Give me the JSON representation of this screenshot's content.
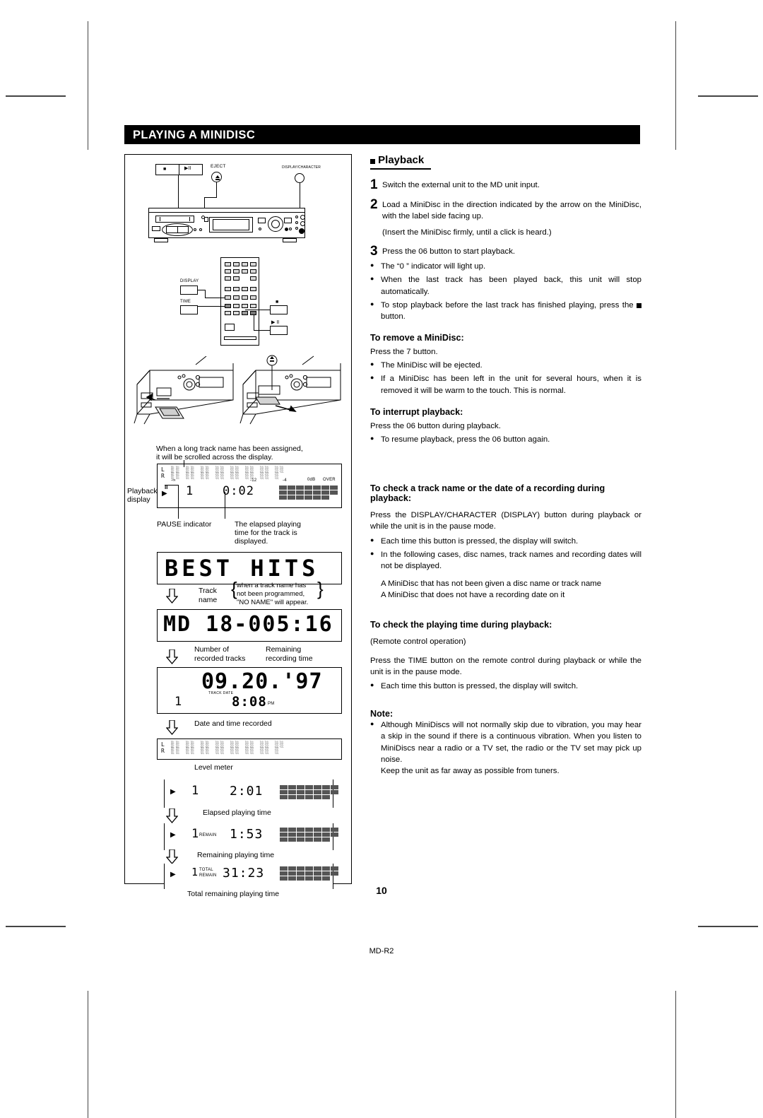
{
  "page": {
    "section_title": "PLAYING A MINIDISC",
    "page_number": "10",
    "footer_code": "MD-R2"
  },
  "diagram": {
    "deck_callouts": {
      "stop": "■",
      "play_pause": "▶II",
      "eject": "EJECT",
      "display_character": "DISPLAY/CHARACTER"
    },
    "remote_callouts": {
      "display": "DISPLAY",
      "time": "TIME",
      "stop": "■",
      "play_pause": "▶ II"
    },
    "scroll_note_line1": "When a long track name has been assigned,",
    "scroll_note_line2": "it will be scrolled across the display.",
    "playback_display_label_line1": "Playback",
    "playback_display_label_line2": "display",
    "pause_indicator_label": "PAUSE indicator",
    "elapsed_note_line1": "The elapsed playing",
    "elapsed_note_line2": "time for the track is",
    "elapsed_note_line3": "displayed.",
    "level_meter_label": "Level meter",
    "track_name_label_line1": "Track",
    "track_name_label_line2": "name",
    "no_name_note_line1": "when a track name has",
    "no_name_note_line2": "not been programmed,",
    "no_name_note_line3": "\"NO NAME\" will appear.",
    "num_tracks_label_line1": "Number of",
    "num_tracks_label_line2": "recorded tracks",
    "remaining_rec_label_line1": "Remaining",
    "remaining_rec_label_line2": "recording time",
    "date_time_label": "Date and time recorded",
    "elapsed_playing_label": "Elapsed playing time",
    "remaining_playing_label": "Remaining playing time",
    "total_remaining_label": "Total remaining playing time"
  },
  "lcd": {
    "meter_scale": {
      "minf": "-∞",
      "m12": "-12",
      "m4": "-4",
      "zero": "0dB",
      "over": "OVER"
    },
    "meter_left_id": "L",
    "meter_right_id": "R",
    "playback": {
      "track": "1",
      "time": "0:02"
    },
    "disc_name": "BEST  HITS",
    "disc_info": "MD  18-005:16",
    "date": {
      "value": "09.20.'97",
      "label": "TRACK DATE",
      "track": "1",
      "clock": "8:08",
      "meridiem": "PM"
    },
    "elapsed": {
      "track": "1",
      "time": "2:01"
    },
    "remaining": {
      "track": "1",
      "flag": "REMAIN",
      "time": "1:53"
    },
    "total_remaining": {
      "track": "1",
      "flag1": "TOTAL",
      "flag2": "REMAIN",
      "time": "31:23"
    }
  },
  "body": {
    "playback_heading": "Playback",
    "step1": "Switch the external unit to the MD unit input.",
    "step2_a": "Load a MiniDisc in the direction indicated by the arrow on the MiniDisc, with the label side facing up.",
    "step2_b": "(Insert the MiniDisc firmly, until a click is heard.)",
    "step3": "Press the 06  button to start playback.",
    "step3_b1": "The “0 ” indicator will light up.",
    "step3_b2": "When the last track has been played back, this unit will stop automatically.",
    "step3_b3_pre": "To stop playback before the last track has finished playing, press the ",
    "step3_b3_post": " button.",
    "remove_heading": "To remove a MiniDisc:",
    "remove_p": "Press the 7  button.",
    "remove_b1": "The MiniDisc will be ejected.",
    "remove_b2": "If a MiniDisc has been left in the unit for several hours, when it is removed it will be warm to the touch. This is normal.",
    "interrupt_heading": "To interrupt playback:",
    "interrupt_p": "Press the 06  button during playback.",
    "interrupt_b1": "To resume playback, press the 06  button again.",
    "check_name_heading": "To check a track name or the date of a recording during playback:",
    "check_name_p": "Press the DISPLAY/CHARACTER (DISPLAY) button during playback or while the unit is in the pause mode.",
    "check_name_b1": "Each time this button is pressed, the display will switch.",
    "check_name_b2": "In the following cases, disc names, track names and recording dates will not be displayed.",
    "check_name_c1": "A MiniDisc that has not been given a disc name or track name",
    "check_name_c2": "A MiniDisc that does not have a recording date on it",
    "check_time_heading": "To check the playing time during playback:",
    "check_time_remote": "(Remote control operation)",
    "check_time_p": "Press the TIME button on the remote control during playback or while the unit is in the pause mode.",
    "check_time_b1": "Each time this button is pressed, the display will switch.",
    "note_heading": "Note:",
    "note_b1": "Although MiniDiscs will not normally skip due to vibration, you may hear a skip in the sound if there is a continuous vibration. When you listen to MiniDiscs near a radio or a TV set, the radio or the TV set may pick up noise.",
    "note_b1_extra": "Keep the unit as far away as possible from tuners."
  }
}
